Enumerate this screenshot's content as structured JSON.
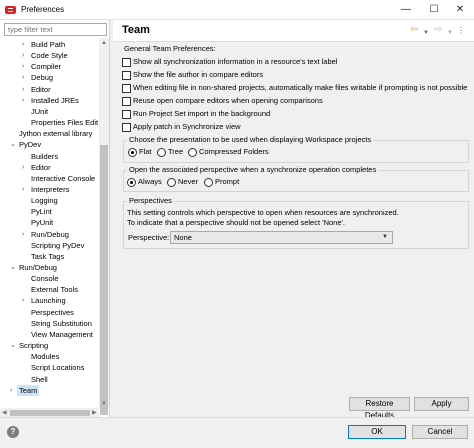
{
  "window": {
    "title": "Preferences",
    "controls": {
      "minimize": "—",
      "maximize": "☐",
      "close": "✕"
    }
  },
  "filter": {
    "placeholder": "type filter text",
    "value": ""
  },
  "tree": [
    {
      "label": "Build Path",
      "level": 2,
      "arrow": "›"
    },
    {
      "label": "Code Style",
      "level": 2,
      "arrow": "›"
    },
    {
      "label": "Compiler",
      "level": 2,
      "arrow": "›"
    },
    {
      "label": "Debug",
      "level": 2,
      "arrow": "›"
    },
    {
      "label": "Editor",
      "level": 2,
      "arrow": "›"
    },
    {
      "label": "Installed JREs",
      "level": 2,
      "arrow": "›"
    },
    {
      "label": "JUnit",
      "level": 2,
      "arrow": ""
    },
    {
      "label": "Properties Files Edito",
      "level": 2,
      "arrow": ""
    },
    {
      "label": "Jython external library",
      "level": 1,
      "arrow": ""
    },
    {
      "label": "PyDev",
      "level": 1,
      "arrow": "⌄"
    },
    {
      "label": "Builders",
      "level": 2,
      "arrow": ""
    },
    {
      "label": "Editor",
      "level": 2,
      "arrow": "›"
    },
    {
      "label": "Interactive Console",
      "level": 2,
      "arrow": ""
    },
    {
      "label": "Interpreters",
      "level": 2,
      "arrow": "›"
    },
    {
      "label": "Logging",
      "level": 2,
      "arrow": ""
    },
    {
      "label": "PyLint",
      "level": 2,
      "arrow": ""
    },
    {
      "label": "PyUnit",
      "level": 2,
      "arrow": ""
    },
    {
      "label": "Run/Debug",
      "level": 2,
      "arrow": "›"
    },
    {
      "label": "Scripting PyDev",
      "level": 2,
      "arrow": ""
    },
    {
      "label": "Task Tags",
      "level": 2,
      "arrow": ""
    },
    {
      "label": "Run/Debug",
      "level": 1,
      "arrow": "⌄"
    },
    {
      "label": "Console",
      "level": 2,
      "arrow": ""
    },
    {
      "label": "External Tools",
      "level": 2,
      "arrow": ""
    },
    {
      "label": "Launching",
      "level": 2,
      "arrow": "›"
    },
    {
      "label": "Perspectives",
      "level": 2,
      "arrow": ""
    },
    {
      "label": "String Substitution",
      "level": 2,
      "arrow": ""
    },
    {
      "label": "View Management",
      "level": 2,
      "arrow": ""
    },
    {
      "label": "Scripting",
      "level": 1,
      "arrow": "⌄"
    },
    {
      "label": "Modules",
      "level": 2,
      "arrow": ""
    },
    {
      "label": "Script Locations",
      "level": 2,
      "arrow": ""
    },
    {
      "label": "Shell",
      "level": 2,
      "arrow": ""
    },
    {
      "label": "Team",
      "level": 1,
      "arrow": "›",
      "selected": true
    }
  ],
  "page": {
    "title": "Team",
    "section_label": "General Team Preferences:",
    "checkboxes": [
      {
        "label": "Show all synchronization information in a resource's text label",
        "checked": false
      },
      {
        "label": "Show the file author in compare editors",
        "checked": false
      },
      {
        "label": "When editing file in non-shared projects, automatically make files writable if prompting is not possible",
        "checked": false
      },
      {
        "label": "Reuse open compare editors when opening comparisons",
        "checked": false
      },
      {
        "label": "Run Project Set import in the background",
        "checked": false
      },
      {
        "label": "Apply patch in Synchronize view",
        "checked": false
      }
    ],
    "presentation_group": {
      "title": "Choose the presentation to be used when displaying Workspace projects",
      "options": [
        {
          "label": "Flat",
          "selected": true
        },
        {
          "label": "Tree",
          "selected": false
        },
        {
          "label": "Compressed Folders",
          "selected": false
        }
      ]
    },
    "perspective_group": {
      "title": "Open the associated perspective when a synchronize operation completes",
      "options": [
        {
          "label": "Always",
          "selected": true
        },
        {
          "label": "Never",
          "selected": false
        },
        {
          "label": "Prompt",
          "selected": false
        }
      ]
    },
    "perspectives_group": {
      "title": "Perspectives",
      "desc1": "This setting controls which perspective to open when resources are synchronized.",
      "desc2": "To indicate that a perspective should not be opened select 'None'.",
      "select_label": "Perspective:",
      "select_value": "None"
    },
    "buttons": {
      "restore": "Restore Defaults",
      "apply": "Apply"
    }
  },
  "dialog_buttons": {
    "ok": "OK",
    "cancel": "Cancel"
  },
  "help": "?"
}
